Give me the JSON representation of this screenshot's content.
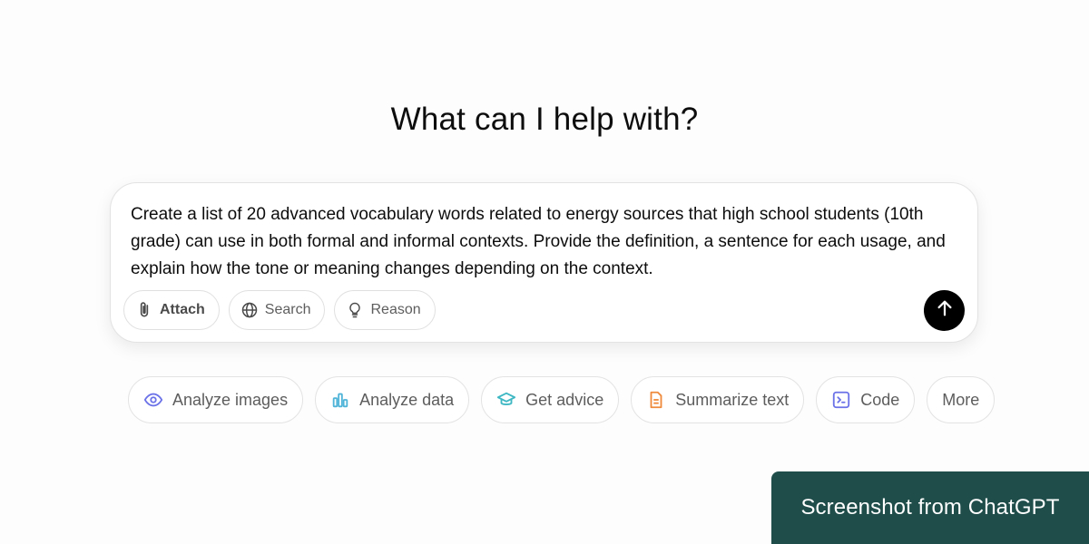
{
  "headline": "What can I help with?",
  "composer": {
    "text": "Create a list of 20 advanced vocabulary words related to energy sources that high school students (10th grade) can use in both formal and informal contexts. Provide the definition, a sentence for each usage, and explain how the tone or meaning changes depending on the context.",
    "tools": [
      {
        "label": "Attach",
        "icon": "paperclip-icon"
      },
      {
        "label": "Search",
        "icon": "globe-icon"
      },
      {
        "label": "Reason",
        "icon": "lightbulb-icon"
      }
    ],
    "send_icon": "arrow-up-icon"
  },
  "suggestions": [
    {
      "label": "Analyze images",
      "icon": "eye-icon",
      "color": "#6b72e8"
    },
    {
      "label": "Analyze data",
      "icon": "bar-chart-icon",
      "color": "#4fb4d8"
    },
    {
      "label": "Get advice",
      "icon": "graduation-cap-icon",
      "color": "#3fb8c4"
    },
    {
      "label": "Summarize text",
      "icon": "document-icon",
      "color": "#ef8a3c"
    },
    {
      "label": "Code",
      "icon": "terminal-icon",
      "color": "#6b72e8"
    },
    {
      "label": "More",
      "icon": "",
      "color": ""
    }
  ],
  "watermark": "Screenshot from ChatGPT"
}
